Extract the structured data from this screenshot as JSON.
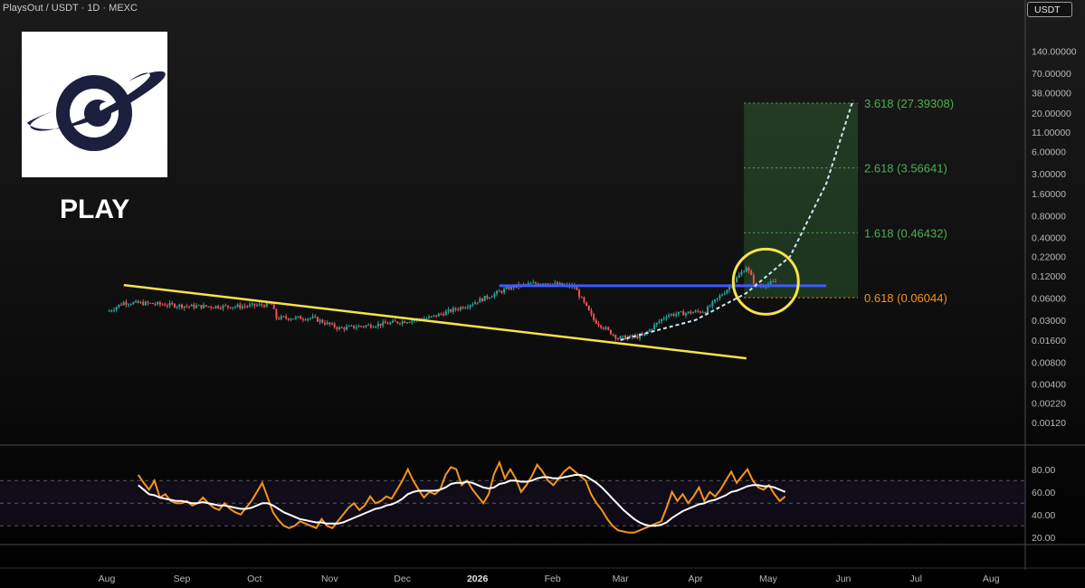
{
  "header": {
    "title": "PlaysOut / USDT · 1D · MEXC",
    "currency": "USDT"
  },
  "logo": {
    "ticker": "PLAY",
    "name": "planet-eye-logo"
  },
  "colors": {
    "up_candle": "#26a69a",
    "down_candle": "#ef5350",
    "trendline": "#f7e24b",
    "resistance": "#3d5afe",
    "fib_low": "#f7931a",
    "fib_high": "#4caf50",
    "projection": "#cde8ff",
    "rsi": "#f7931a",
    "rsi_ma": "#ffffff",
    "highlight_circle": "#f7e24b"
  },
  "chart_data": [
    {
      "type": "candlestick",
      "title": "PlaysOut / USDT · 1D · MEXC",
      "y_scale": "log",
      "y_ticks": [
        "140.00000",
        "70.00000",
        "38.00000",
        "20.00000",
        "11.00000",
        "6.00000",
        "3.00000",
        "1.60000",
        "0.80000",
        "0.40000",
        "0.22000",
        "0.12000",
        "0.06000",
        "0.03000",
        "0.01600",
        "0.00800",
        "0.00400",
        "0.00220",
        "0.00120"
      ],
      "x_ticks": [
        "Aug",
        "Sep",
        "Oct",
        "Nov",
        "Dec",
        "2026",
        "Feb",
        "Mar",
        "Apr",
        "May",
        "Jun",
        "Jul",
        "Aug"
      ],
      "price_path": [
        {
          "date": "2025-08-02",
          "close": 0.04
        },
        {
          "date": "2025-08-08",
          "close": 0.052
        },
        {
          "date": "2025-08-20",
          "close": 0.05
        },
        {
          "date": "2025-09-05",
          "close": 0.046
        },
        {
          "date": "2025-09-25",
          "close": 0.046
        },
        {
          "date": "2025-10-08",
          "close": 0.049
        },
        {
          "date": "2025-10-10",
          "close": 0.032
        },
        {
          "date": "2025-10-25",
          "close": 0.032
        },
        {
          "date": "2025-11-05",
          "close": 0.023
        },
        {
          "date": "2025-11-25",
          "close": 0.027
        },
        {
          "date": "2025-12-12",
          "close": 0.032
        },
        {
          "date": "2025-12-28",
          "close": 0.048
        },
        {
          "date": "2026-01-15",
          "close": 0.085
        },
        {
          "date": "2026-01-28",
          "close": 0.098
        },
        {
          "date": "2026-02-10",
          "close": 0.085
        },
        {
          "date": "2026-02-18",
          "close": 0.03
        },
        {
          "date": "2026-02-28",
          "close": 0.017
        },
        {
          "date": "2026-03-10",
          "close": 0.018
        },
        {
          "date": "2026-03-20",
          "close": 0.035
        },
        {
          "date": "2026-04-05",
          "close": 0.04
        },
        {
          "date": "2026-04-15",
          "close": 0.085
        },
        {
          "date": "2026-04-22",
          "close": 0.16
        },
        {
          "date": "2026-04-26",
          "close": 0.085
        },
        {
          "date": "2026-05-05",
          "close": 0.1
        }
      ],
      "fib_levels": [
        {
          "ratio": "3.618",
          "label": "3.618 (27.39308)",
          "value": 27.39308
        },
        {
          "ratio": "2.618",
          "label": "2.618 (3.56641)",
          "value": 3.56641
        },
        {
          "ratio": "1.618",
          "label": "1.618 (0.46432)",
          "value": 0.46432
        },
        {
          "ratio": "0.618",
          "label": "0.618 (0.06044)",
          "value": 0.06044
        }
      ],
      "trendline": [
        {
          "date": "2025-08-08",
          "value": 0.09
        },
        {
          "date": "2026-04-22",
          "value": 0.009
        }
      ],
      "resistance": {
        "value": 0.088,
        "from": "2026-01-10",
        "to": "2026-05-25"
      },
      "projection": [
        {
          "date": "2026-03-01",
          "value": 0.016
        },
        {
          "date": "2026-04-01",
          "value": 0.03
        },
        {
          "date": "2026-04-22",
          "value": 0.07
        },
        {
          "date": "2026-05-10",
          "value": 0.22
        },
        {
          "date": "2026-05-25",
          "value": 2.2
        },
        {
          "date": "2026-06-05",
          "value": 30
        }
      ],
      "highlight": {
        "date": "2026-04-30",
        "value": 0.1
      }
    },
    {
      "type": "line",
      "name": "RSI",
      "y_ticks": [
        "80.00",
        "60.00",
        "40.00",
        "20.00"
      ],
      "ylim": [
        15,
        95
      ],
      "series": [
        {
          "values": [
            75,
            68,
            62,
            70,
            55,
            58,
            52,
            50,
            50,
            52,
            48,
            50,
            55,
            50,
            46,
            44,
            50,
            45,
            42,
            40,
            46,
            52,
            60,
            68,
            55,
            42,
            35,
            30,
            28,
            30,
            34,
            32,
            30,
            28,
            36,
            30,
            28,
            34,
            40,
            46,
            50,
            44,
            48,
            56,
            50,
            52,
            56,
            54,
            62,
            70,
            80,
            70,
            62,
            55,
            60,
            58,
            62,
            75,
            82,
            80,
            66,
            70,
            62,
            56,
            50,
            58,
            76,
            86,
            72,
            80,
            72,
            60,
            66,
            74,
            84,
            78,
            70,
            66,
            72,
            78,
            82,
            78,
            74,
            70,
            58,
            50,
            44,
            36,
            30,
            26,
            25,
            24,
            24,
            26,
            28,
            30,
            32,
            34,
            46,
            60,
            52,
            58,
            50,
            56,
            64,
            52,
            60,
            56,
            62,
            70,
            78,
            68,
            74,
            80,
            70,
            64,
            62,
            66,
            58,
            52,
            56
          ]
        },
        {
          "values": [
            66,
            62,
            58,
            57,
            55,
            54,
            53,
            52,
            52,
            51,
            50,
            50,
            51,
            50,
            49,
            48,
            48,
            47,
            46,
            45,
            45,
            46,
            48,
            50,
            50,
            48,
            45,
            42,
            40,
            38,
            36,
            35,
            34,
            33,
            33,
            32,
            32,
            32,
            33,
            35,
            37,
            39,
            41,
            43,
            45,
            46,
            48,
            49,
            51,
            54,
            58,
            60,
            61,
            61,
            61,
            61,
            62,
            64,
            67,
            68,
            68,
            69,
            68,
            66,
            64,
            63,
            64,
            67,
            68,
            70,
            70,
            69,
            69,
            70,
            72,
            73,
            73,
            72,
            72,
            73,
            74,
            75,
            75,
            74,
            71,
            68,
            64,
            59,
            54,
            49,
            44,
            40,
            36,
            33,
            31,
            30,
            30,
            31,
            33,
            37,
            40,
            43,
            45,
            47,
            49,
            50,
            52,
            53,
            55,
            57,
            60,
            61,
            63,
            65,
            66,
            66,
            65,
            65,
            64,
            62,
            60
          ]
        }
      ]
    }
  ]
}
